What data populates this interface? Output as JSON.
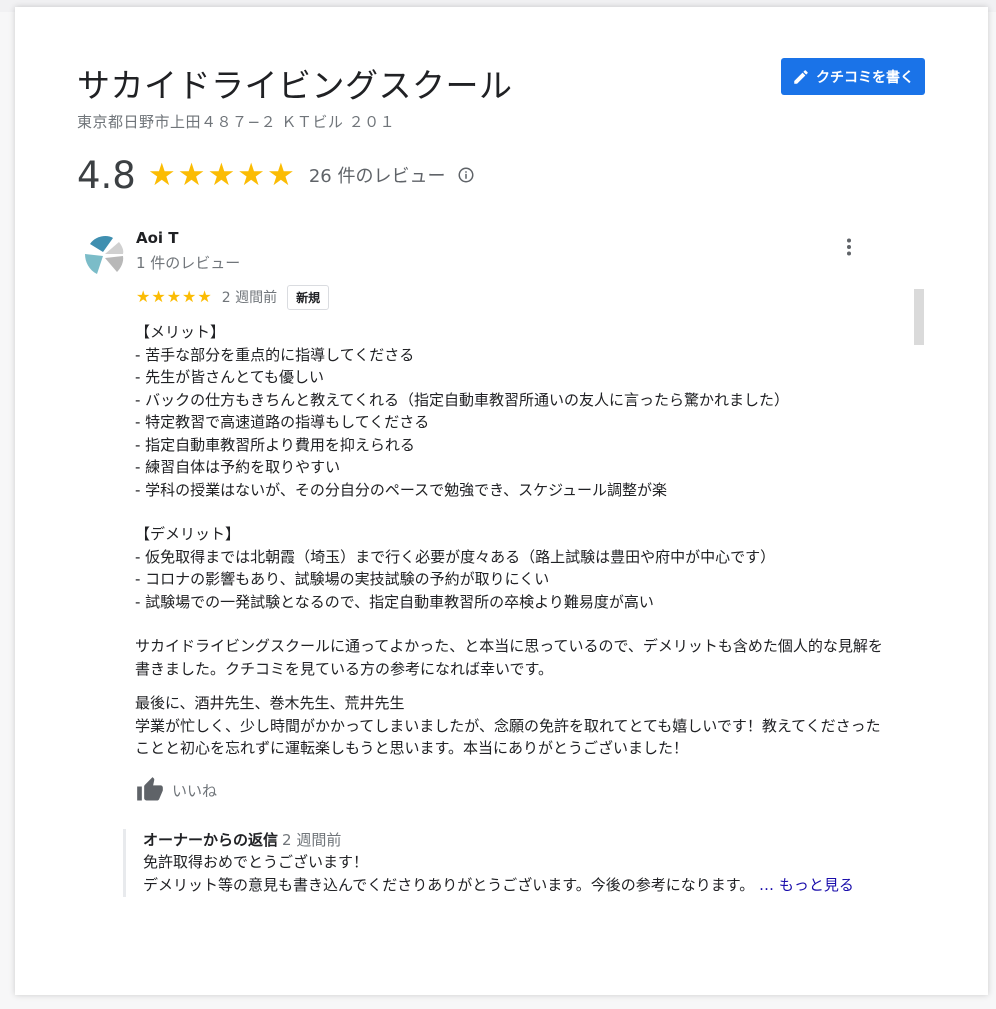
{
  "business": {
    "name": "サカイドライビングスクール",
    "address": "東京都日野市上田４８７−２ ＫＴビル ２０１",
    "rating": "4.8",
    "review_count": "26 件のレビュー",
    "write_review_label": "クチコミを書く"
  },
  "review": {
    "author": "Aoi T",
    "author_reviews": "1 件のレビュー",
    "stars": 5,
    "time": "2 週間前",
    "badge": "新規",
    "merits": "【メリット】\n- 苦手な部分を重点的に指導してくださる\n- 先生が皆さんとても優しい\n- バックの仕方もきちんと教えてくれる（指定自動車教習所通いの友人に言ったら驚かれました）\n- 特定教習で高速道路の指導もしてくださる\n- 指定自動車教習所より費用を抑えられる\n- 練習自体は予約を取りやすい\n- 学科の授業はないが、その分自分のペースで勉強でき、スケジュール調整が楽",
    "demerits": "【デメリット】\n- 仮免取得までは北朝霞（埼玉）まで行く必要が度々ある（路上試験は豊田や府中が中心です）\n- コロナの影響もあり、試験場の実技試験の予約が取りにくい\n- 試験場での一発試験となるので、指定自動車教習所の卒検より難易度が高い",
    "summary": "サカイドライビングスクールに通ってよかった、と本当に思っているので、デメリットも含めた個人的な見解を書きました。クチコミを見ている方の参考になれば幸いです。",
    "closing": "最後に、酒井先生、巻木先生、荒井先生\n学業が忙しく、少し時間がかかってしまいましたが、念願の免許を取れてとても嬉しいです！教えてくださったことと初心を忘れずに運転楽しもうと思います。本当にありがとうございました！",
    "like_label": "いいね"
  },
  "owner_reply": {
    "title": "オーナーからの返信",
    "time": "2 週間前",
    "text": "免許取得おめでとうございます！\nデメリット等の意見も書き込んでくださりありがとうございます。今後の参考になります。",
    "more_label": "… もっと見る"
  },
  "colors": {
    "accent": "#1a73e8",
    "star": "#fbbc04",
    "link": "#1a0dab"
  }
}
